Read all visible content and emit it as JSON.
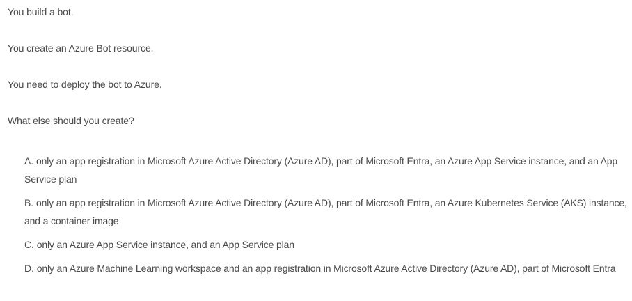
{
  "question": {
    "lines": [
      "You build a bot.",
      "You create an Azure Bot resource.",
      "You need to deploy the bot to Azure.",
      "What else should you create?"
    ]
  },
  "choices": [
    {
      "letter": "A.",
      "text": "only an app registration in Microsoft Azure Active Directory (Azure AD), part of Microsoft Entra, an Azure App Service instance, and an App Service plan"
    },
    {
      "letter": "B.",
      "text": "only an app registration in Microsoft Azure Active Directory (Azure AD), part of Microsoft Entra, an Azure Kubernetes Service (AKS) instance, and a container image"
    },
    {
      "letter": "C.",
      "text": "only an Azure App Service instance, and an App Service plan"
    },
    {
      "letter": "D.",
      "text": "only an Azure Machine Learning workspace and an app registration in Microsoft Azure Active Directory (Azure AD), part of Microsoft Entra"
    }
  ]
}
